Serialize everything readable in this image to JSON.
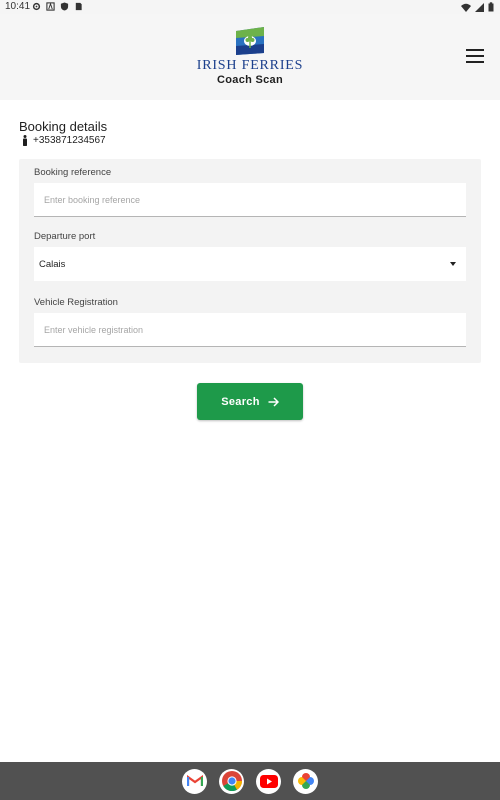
{
  "status_bar": {
    "time": "10:41",
    "left_icons": [
      "gear-icon",
      "a-icon",
      "shield-icon",
      "sim-icon"
    ],
    "right_icons": [
      "wifi-icon",
      "signal-icon",
      "battery-icon"
    ]
  },
  "header": {
    "brand": "IRISH FERRIES",
    "subtitle": "Coach Scan",
    "menu_icon": "hamburger-menu-icon"
  },
  "booking": {
    "title": "Booking details",
    "phone": "+353871234567",
    "phone_icon": "person-icon"
  },
  "form": {
    "booking_reference": {
      "label": "Booking reference",
      "placeholder": "Enter booking reference",
      "value": ""
    },
    "departure_port": {
      "label": "Departure port",
      "selected": "Calais"
    },
    "vehicle_registration": {
      "label": "Vehicle Registration",
      "placeholder": "Enter vehicle registration",
      "value": ""
    }
  },
  "actions": {
    "search_label": "Search"
  },
  "nav_apps": [
    "gmail-icon",
    "chrome-icon",
    "youtube-icon",
    "photos-icon"
  ],
  "colors": {
    "accent": "#1e9a4a",
    "brand_blue": "#1b3f8c",
    "header_bg": "#f6f6f6",
    "card_bg": "#f3f3f3",
    "navbar_bg": "#515151"
  }
}
